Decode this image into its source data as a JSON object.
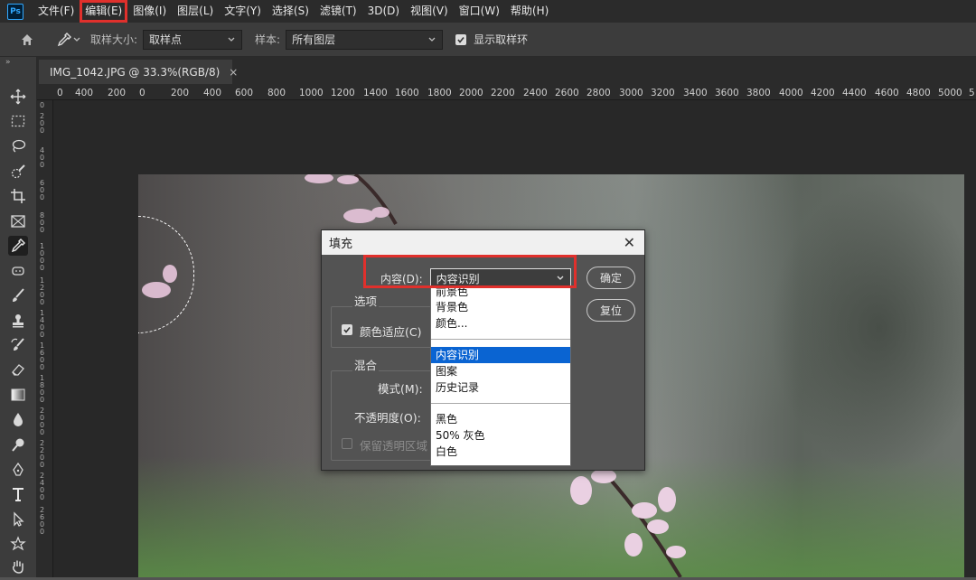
{
  "menubar": {
    "logo": "Ps",
    "items": [
      "文件(F)",
      "编辑(E)",
      "图像(I)",
      "图层(L)",
      "文字(Y)",
      "选择(S)",
      "滤镜(T)",
      "3D(D)",
      "视图(V)",
      "窗口(W)",
      "帮助(H)"
    ]
  },
  "options": {
    "sample_size_label": "取样大小:",
    "sample_size_value": "取样点",
    "sample_label": "样本:",
    "sample_value": "所有图层",
    "show_ring_label": "显示取样环"
  },
  "tab": {
    "title": "IMG_1042.JPG @ 33.3%(RGB/8)",
    "close": "×"
  },
  "ruler_top": [
    "0",
    "400",
    "200",
    "0",
    "200",
    "400",
    "600",
    "800",
    "1000",
    "1200",
    "1400",
    "1600",
    "1800",
    "2000",
    "2200",
    "2400",
    "2600",
    "2800",
    "3000",
    "3200",
    "3400",
    "3600",
    "3800",
    "4000",
    "4200",
    "4400",
    "4600",
    "4800",
    "5000",
    "5"
  ],
  "ruler_left": [
    "0",
    "2 0 0",
    "4 0 0",
    "6 0 0",
    "8 0 0",
    "1 0 0 0",
    "1 2 0 0",
    "1 4 0 0",
    "1 6 0 0",
    "1 8 0 0",
    "2 0 0 0",
    "2 2 0 0",
    "2 4 0 0",
    "2 6 0 0"
  ],
  "dialog": {
    "title": "填充",
    "close": "✕",
    "content_label": "内容(D):",
    "content_value": "内容识别",
    "ok": "确定",
    "reset": "复位",
    "options_group": "选项",
    "color_adapt": "颜色适应(C)",
    "blend_group": "混合",
    "mode_label": "模式(M):",
    "opacity_label": "不透明度(O):",
    "preserve_label": "保留透明区域"
  },
  "dropdown": {
    "group1": [
      "前景色",
      "背景色",
      "颜色..."
    ],
    "group2": [
      "内容识别",
      "图案",
      "历史记录"
    ],
    "group3": [
      "黑色",
      "50% 灰色",
      "白色"
    ],
    "selected": "内容识别"
  },
  "colors": {
    "highlight_box": "#e0302c",
    "selection_blue": "#0a64d2"
  }
}
